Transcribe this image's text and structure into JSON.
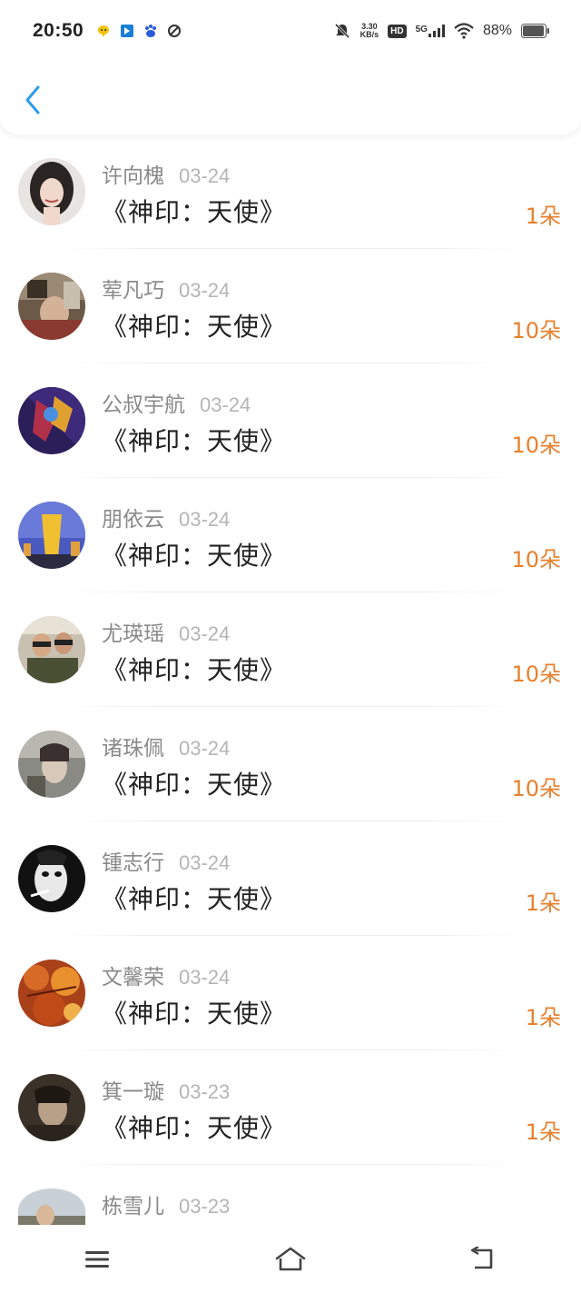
{
  "status_bar": {
    "time": "20:50",
    "net_speed_top": "3.30",
    "net_speed_bottom": "KB/s",
    "hd": "HD",
    "network": "5G",
    "battery": "88%"
  },
  "navbar": {
    "back_icon": "chevron-left-icon",
    "accent": "#2f9be8"
  },
  "list": {
    "items": [
      {
        "name": "许向槐",
        "date": "03-24",
        "book": "《神印：天使》",
        "qty": "1朵"
      },
      {
        "name": "荤凡巧",
        "date": "03-24",
        "book": "《神印：天使》",
        "qty": "10朵"
      },
      {
        "name": "公叔宇航",
        "date": "03-24",
        "book": "《神印：天使》",
        "qty": "10朵"
      },
      {
        "name": "朋依云",
        "date": "03-24",
        "book": "《神印：天使》",
        "qty": "10朵"
      },
      {
        "name": "尤瑛瑶",
        "date": "03-24",
        "book": "《神印：天使》",
        "qty": "10朵"
      },
      {
        "name": "诸珠佩",
        "date": "03-24",
        "book": "《神印：天使》",
        "qty": "10朵"
      },
      {
        "name": "锺志行",
        "date": "03-24",
        "book": "《神印：天使》",
        "qty": "1朵"
      },
      {
        "name": "文馨荣",
        "date": "03-24",
        "book": "《神印：天使》",
        "qty": "1朵"
      },
      {
        "name": "箕一璇",
        "date": "03-23",
        "book": "《神印：天使》",
        "qty": "1朵"
      },
      {
        "name": "栋雪儿",
        "date": "03-23",
        "book": "",
        "qty": ""
      }
    ]
  },
  "colors": {
    "qty": "#e8802e",
    "name": "#8a8a8a",
    "date": "#b5b5b5"
  },
  "bottom_nav": {
    "icons": [
      "menu-icon",
      "home-icon",
      "back-icon"
    ]
  }
}
